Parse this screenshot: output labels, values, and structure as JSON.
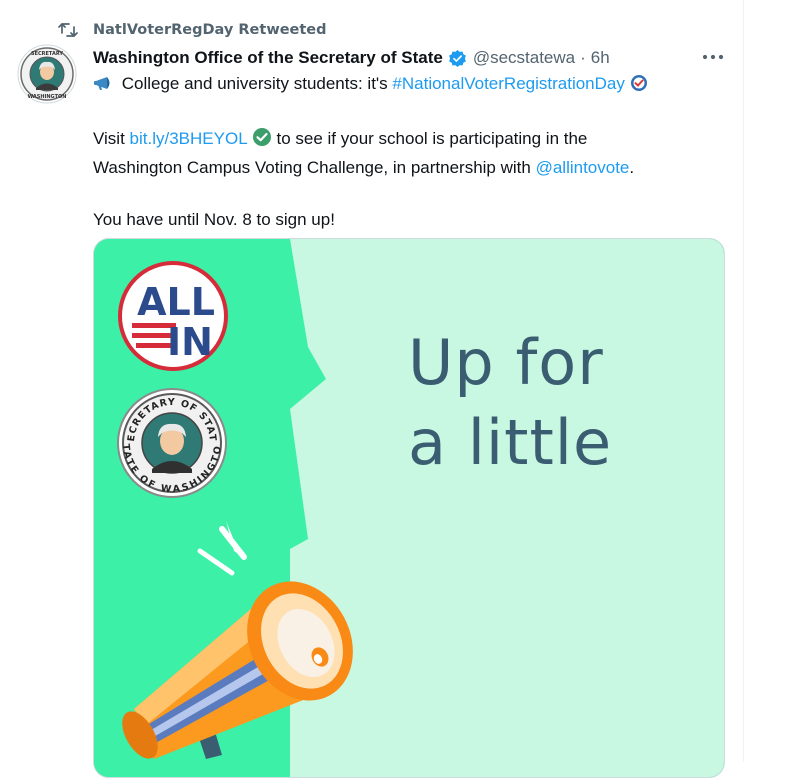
{
  "retweet_header": {
    "text": "NatlVoterRegDay Retweeted",
    "icon": "retweet-icon"
  },
  "author": {
    "name": "Washington Office of the Secretary of State",
    "handle": "@secstatewa",
    "separator": "·",
    "time": "6h",
    "verified_icon": "verified-badge-icon",
    "avatar_icon": "secretary-of-state-seal-icon"
  },
  "more_button": {
    "label": "···"
  },
  "tweet": {
    "line1_text": "College and university students: it's ",
    "line1_hashtag": "#NationalVoterRegistrationDay",
    "line2_prefix": "Visit ",
    "line2_link": "bit.ly/3BHEYOL",
    "line2_middle": " to see if your school is participating in the",
    "line3_text": "Washington Campus Voting Challenge, in partnership with ",
    "line3_mention": "@allintovote",
    "line3_suffix": ".",
    "line4_text": "You have until Nov. 8 to sign up!"
  },
  "media": {
    "headline_line1": "Up for",
    "headline_line2": "a little",
    "allin_logo_top": "ALL",
    "allin_logo_bottom": "IN",
    "seal_text_top": "SECRETARY OF STATE",
    "seal_text_bottom": "STATE OF WASHINGTON"
  },
  "colors": {
    "link": "#1d9bf0",
    "secondary_text": "#536471",
    "media_green": "#3df0a7",
    "media_mint": "#c8f8e2",
    "headline": "#3b5d72",
    "megaphone_orange": "#f98a16"
  }
}
